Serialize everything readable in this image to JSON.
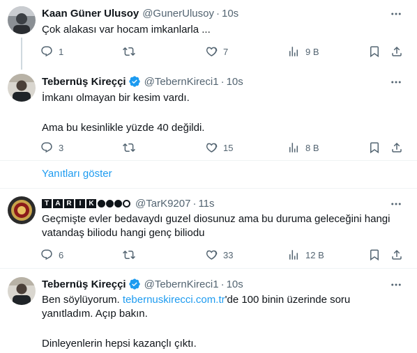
{
  "tweets": [
    {
      "name": "Kaan Güner Ulusoy",
      "handle": "@GunerUlusoy",
      "dot": "·",
      "time": "10s",
      "lines": [
        "Çok alakası var hocam imkanlarla ..."
      ],
      "replies": "1",
      "retweets": "",
      "likes": "7",
      "views": "9 B"
    },
    {
      "name": "Tebernüş Kireççi",
      "handle": "@TebernKireci1",
      "dot": "·",
      "time": "10s",
      "line1": "İmkanı olmayan bir kesim vardı.",
      "line2": "Ama bu kesinlikle yüzde 40 değildi.",
      "replies": "3",
      "retweets": "",
      "likes": "15",
      "views": "8 B"
    },
    {
      "name_letters": [
        "T",
        "A",
        "R",
        "I",
        "K"
      ],
      "handle": "@TarK9207",
      "dot": "·",
      "time": "11s",
      "line1": "Geçmişte evler bedavaydı guzel diosunuz ama bu duruma geleceğini hangi",
      "line2": "vatandaş biliodu hangi genç biliodu",
      "replies": "6",
      "retweets": "",
      "likes": "33",
      "views": "12 B"
    },
    {
      "name": "Tebernüş Kireççi",
      "handle": "@TebernKireci1",
      "dot": "·",
      "time": "10s",
      "line1_a": "Ben söylüyorum. ",
      "line1_link": "tebernuskirecci.com.tr",
      "line1_b": "'de 100 binin üzerinde soru",
      "line2": "yanıtladım. Açıp bakın.",
      "line3": "Dinleyenlerin hepsi kazançlı çıktı."
    }
  ],
  "show_replies": "Yanıtları göster",
  "colors": {
    "accent": "#1d9bf0",
    "secondary_text": "#536471",
    "primary_text": "#0f1419",
    "divider": "#eff3f4"
  }
}
